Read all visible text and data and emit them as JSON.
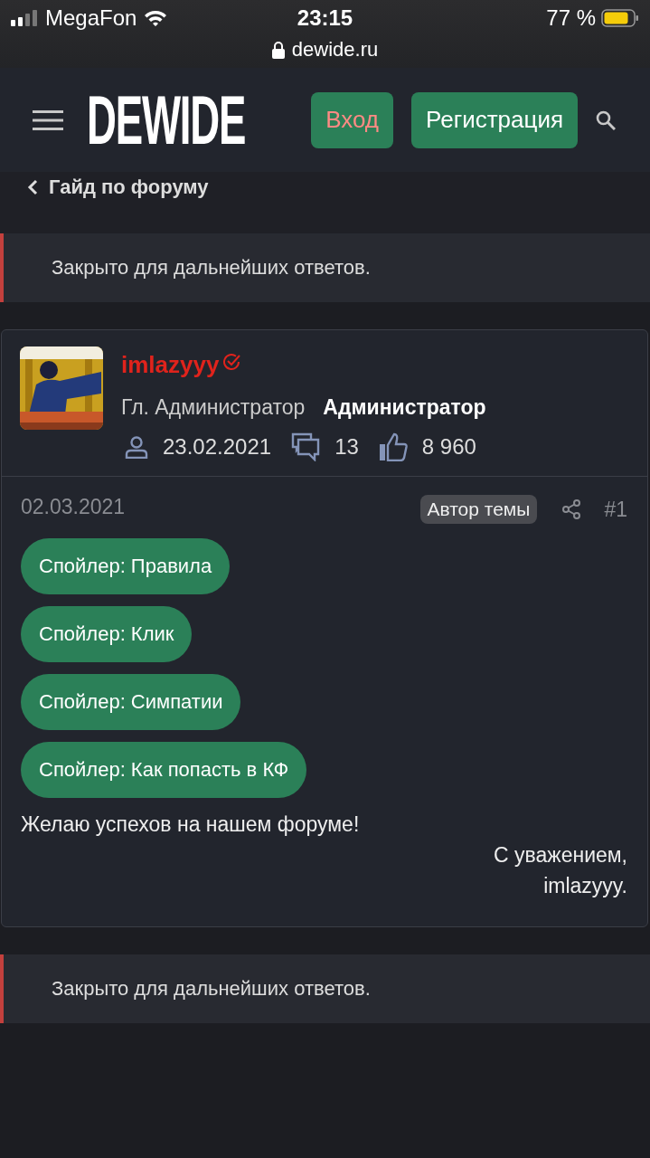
{
  "status_bar": {
    "carrier": "MegaFon",
    "time": "23:15",
    "battery": "77 %",
    "url": "dewide.ru"
  },
  "header": {
    "logo": "DEWIDE",
    "buttons": [
      {
        "label": "Вход",
        "kind": "login"
      },
      {
        "label": "Регистрация",
        "kind": "register"
      }
    ]
  },
  "breadcrumb": "Гайд по форуму",
  "notice_top": "Закрыто для дальнейших ответов.",
  "post": {
    "author": {
      "name": "imlazyyy",
      "verified": true,
      "title": "Гл. Администратор",
      "role": "Администратор",
      "joined": "23.02.2021",
      "messages": "13",
      "reactions": "8 960"
    },
    "date": "02.03.2021",
    "author_badge": "Автор темы",
    "number": "#1",
    "spoilers": [
      "Спойлер: Правила",
      "Спойлер: Клик",
      "Спойлер: Симпатии",
      "Спойлер: Как попасть в КФ"
    ],
    "body": "Желаю успехов на нашем форуме!",
    "signature": [
      "С уважением,",
      "imlazyyy."
    ]
  },
  "notice_bottom": "Закрыто для дальнейших ответов."
}
